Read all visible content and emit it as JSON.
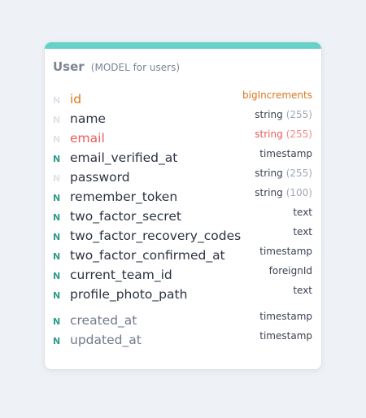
{
  "model": {
    "name": "User",
    "subtitle": "(MODEL for users)"
  },
  "nullable_flag": "N",
  "colors": {
    "accent": "#66d1c8",
    "primary_key": "#d9771f",
    "unique": "#ef5a5a",
    "nullable_on": "#2f9c8a",
    "nullable_off": "#dfe3ea"
  },
  "fields": [
    {
      "name": "id",
      "type": "bigIncrements",
      "length": "",
      "nullable": false,
      "style": "primary"
    },
    {
      "name": "name",
      "type": "string",
      "length": "(255)",
      "nullable": false,
      "style": "normal"
    },
    {
      "name": "email",
      "type": "string",
      "length": "(255)",
      "nullable": false,
      "style": "unique"
    },
    {
      "name": "email_verified_at",
      "type": "timestamp",
      "length": "",
      "nullable": true,
      "style": "normal"
    },
    {
      "name": "password",
      "type": "string",
      "length": "(255)",
      "nullable": false,
      "style": "normal"
    },
    {
      "name": "remember_token",
      "type": "string",
      "length": "(100)",
      "nullable": true,
      "style": "normal"
    },
    {
      "name": "two_factor_secret",
      "type": "text",
      "length": "",
      "nullable": true,
      "style": "normal"
    },
    {
      "name": "two_factor_recovery_codes",
      "type": "text",
      "length": "",
      "nullable": true,
      "style": "normal"
    },
    {
      "name": "two_factor_confirmed_at",
      "type": "timestamp",
      "length": "",
      "nullable": true,
      "style": "normal"
    },
    {
      "name": "current_team_id",
      "type": "foreignId",
      "length": "",
      "nullable": true,
      "style": "normal"
    },
    {
      "name": "profile_photo_path",
      "type": "text",
      "length": "",
      "nullable": true,
      "style": "normal"
    },
    {
      "name": "created_at",
      "type": "timestamp",
      "length": "",
      "nullable": true,
      "style": "timestamps"
    },
    {
      "name": "updated_at",
      "type": "timestamp",
      "length": "",
      "nullable": true,
      "style": "timestamps"
    }
  ]
}
